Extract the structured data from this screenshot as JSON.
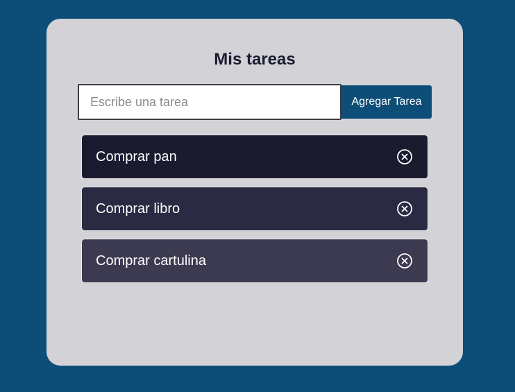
{
  "app": {
    "title": "Mis tareas"
  },
  "form": {
    "input_value": "",
    "input_placeholder": "Escribe una tarea",
    "add_button_label": "Agregar Tarea"
  },
  "tasks": [
    {
      "text": "Comprar pan",
      "delete_icon": "close-circle-icon"
    },
    {
      "text": "Comprar libro",
      "delete_icon": "close-circle-icon"
    },
    {
      "text": "Comprar cartulina",
      "delete_icon": "close-circle-icon"
    }
  ],
  "colors": {
    "page_background": "#0d4e78",
    "card_background": "#d2d2d7",
    "button_background": "#0d4e78",
    "task_item_1": "#1b1b30",
    "task_item_2": "#2a2a42",
    "task_item_3": "#3b3a50"
  }
}
